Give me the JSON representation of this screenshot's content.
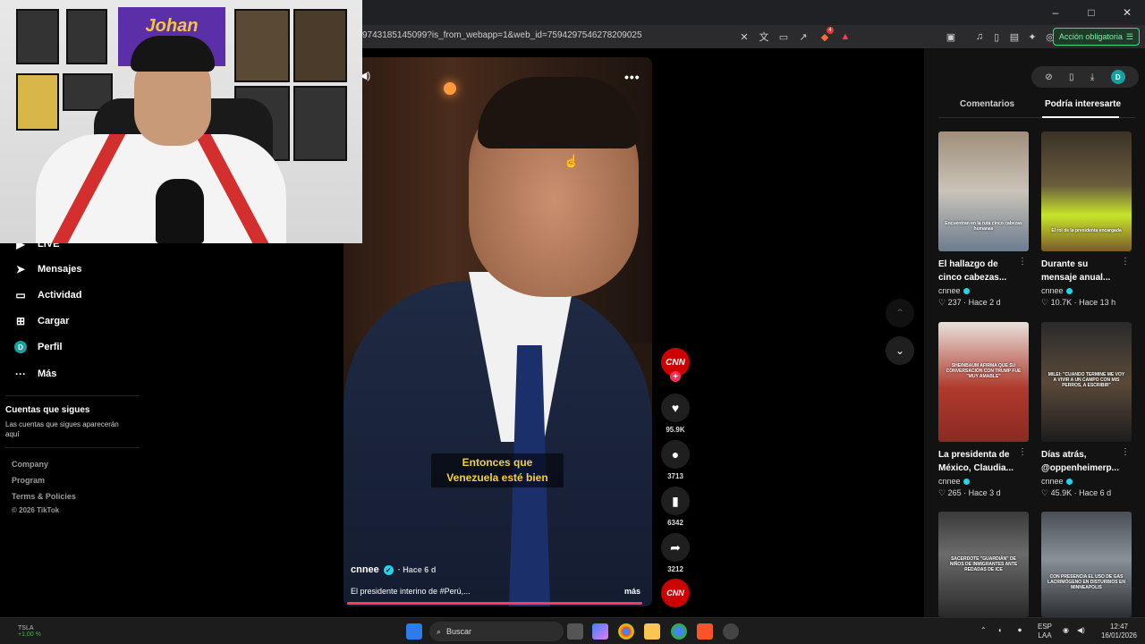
{
  "browser": {
    "url": "97431851450​99?is_from_webapp=1&web_id=7594297546278209025",
    "action_button": "Acción obligatoria",
    "window_controls": [
      "–",
      "□",
      "✕"
    ]
  },
  "sidebar": {
    "partial_item": "LIVE",
    "items": [
      {
        "label": "Mensajes",
        "icon": "send-icon"
      },
      {
        "label": "Actividad",
        "icon": "activity-icon"
      },
      {
        "label": "Cargar",
        "icon": "upload-icon"
      },
      {
        "label": "Perfil",
        "icon": "avatar",
        "avatar_letter": "D"
      },
      {
        "label": "Más",
        "icon": "more-icon"
      }
    ],
    "following_title": "Cuentas que sigues",
    "following_sub": "Las cuentas que sigues aparecerán aquí",
    "footer_links": [
      "Company",
      "Program",
      "Terms & Policies"
    ],
    "copyright": "© 2026 TikTok"
  },
  "webcam": {
    "poster_text": "Johan"
  },
  "video": {
    "caption_line1": "Entonces que",
    "caption_line2": "Venezuela esté bien",
    "author": "cnnee",
    "time": "· Hace 6 d",
    "description": "El presidente interino de #Perú,...",
    "more": "más",
    "progress": 0.98
  },
  "actions": {
    "avatar": "CNN",
    "likes": "95.9K",
    "comments": "3713",
    "saves": "6342",
    "shares": "3212",
    "music": "CNN"
  },
  "right_panel": {
    "me_letter": "D",
    "tabs": [
      "Comentarios",
      "Podría interesarte"
    ],
    "recs": [
      {
        "title": "El hallazgo de cinco cabezas...",
        "author": "cnnee",
        "likes": "♡ 237",
        "time": "· Hace 2 d",
        "thumb_caption": "Encuentran en la ruta cinco cabezas humanas"
      },
      {
        "title": "Durante su mensaje anual...",
        "author": "cnnee",
        "likes": "♡ 10.7K",
        "time": "· Hace 13 h",
        "thumb_caption": "El rol de la presidenta encargada"
      },
      {
        "title": "La presidenta de México, Claudia...",
        "author": "cnnee",
        "likes": "♡ 265",
        "time": "· Hace 3 d",
        "thumb_caption": "SHEINBAUM AFIRMA QUE SU CONVERSACIÓN CON TRUMP FUE \"MUY AMABLE\""
      },
      {
        "title": "Días atrás, @oppenheimerp...",
        "author": "cnnee",
        "likes": "♡ 45.9K",
        "time": "· Hace 6 d",
        "thumb_caption": "MILEI: \"CUANDO TERMINE ME VOY A VIVIR A UN CAMPO CON MIS PERROS, A ESCRIBIR\""
      },
      {
        "title": "",
        "author": "",
        "likes": "",
        "time": "",
        "thumb_caption": "SACERDOTE \"GUARDIÁN\" DE NIÑOS DE INMIGRANTES ANTE REDADAS DE ICE"
      },
      {
        "title": "",
        "author": "",
        "likes": "",
        "time": "",
        "thumb_caption": "CON PRESENCIA EL USO DE GAS LACRIMÓGENO EN DISTURBIOS EN MINNEAPOLIS"
      }
    ]
  },
  "taskbar": {
    "ticker": "TSLA",
    "ticker_change": "+1,00 %",
    "search": "Buscar",
    "lang1": "ESP",
    "lang2": "LAA",
    "time": "12:47",
    "date": "16/01/2026"
  },
  "colors": {
    "accent": "#fe2c55",
    "verified": "#20d5ec",
    "caption": "#f2d13a",
    "cnn": "#cc0000"
  }
}
